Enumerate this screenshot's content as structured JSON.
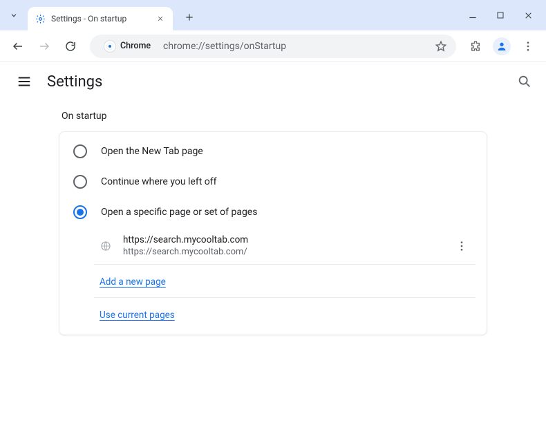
{
  "window": {
    "tab_title": "Settings - On startup",
    "url": "chrome://settings/onStartup",
    "omnibox_chip": "Chrome"
  },
  "appbar": {
    "title": "Settings"
  },
  "section": {
    "heading": "On startup",
    "options": [
      {
        "label": "Open the New Tab page",
        "selected": false
      },
      {
        "label": "Continue where you left off",
        "selected": false
      },
      {
        "label": "Open a specific page or set of pages",
        "selected": true
      }
    ],
    "startup_page": {
      "title": "https://search.mycooltab.com",
      "url": "https://search.mycooltab.com/"
    },
    "add_page_label": "Add a new page",
    "use_current_label": "Use current pages"
  }
}
